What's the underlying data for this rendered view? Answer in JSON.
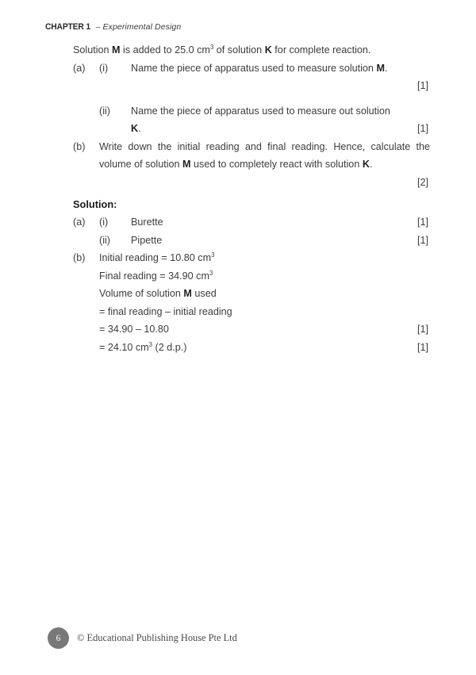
{
  "header": {
    "chapter_label": "CHAPTER 1",
    "separator": " – ",
    "chapter_title": "Experimental Design"
  },
  "question": {
    "stem_before": "Solution ",
    "stem_bold_1": "M",
    "stem_mid": " is added to 25.0 cm",
    "stem_sup": "3",
    "stem_after": " of solution ",
    "stem_bold_2": "K",
    "stem_end": " for complete reaction.",
    "parts": [
      {
        "label": "(a)",
        "sublabel": "(i)",
        "text_before": "Name the piece of apparatus used to measure solution ",
        "bold": "M",
        "text_after": ".",
        "marks": "[1]"
      },
      {
        "label": "",
        "sublabel": "(ii)",
        "text_before": "Name the piece of apparatus used to measure out solution ",
        "bold": "K",
        "text_after": ".",
        "marks": "[1]"
      },
      {
        "label": "(b)",
        "sublabel": "",
        "text_before": "Write down the initial reading and final reading. Hence, calculate the volume of solution ",
        "bold": "M",
        "text_mid": " used to completely react with solution ",
        "bold_2": "K",
        "text_after": ".",
        "marks": "[2]"
      }
    ]
  },
  "solution": {
    "heading": "Solution:",
    "a_label": "(a)",
    "items": [
      {
        "sublabel": "(i)",
        "text": "Burette",
        "marks": "[1]"
      },
      {
        "sublabel": "(ii)",
        "text": "Pipette",
        "marks": "[1]"
      }
    ],
    "b_label": "(b)",
    "b_lines": [
      {
        "text_before": "Initial reading = 10.80 cm",
        "sup": "3",
        "text_after": "",
        "marks": ""
      },
      {
        "text_before": "Final reading = 34.90 cm",
        "sup": "3",
        "text_after": "",
        "marks": ""
      },
      {
        "text_before": "Volume of solution ",
        "bold": "M",
        "text_after": " used",
        "marks": ""
      },
      {
        "text_before": "= final reading – initial reading",
        "text_after": "",
        "marks": ""
      },
      {
        "text_before": "= 34.90 – 10.80",
        "text_after": "",
        "marks": "[1]"
      },
      {
        "text_before": "= 24.10 cm",
        "sup": "3",
        "text_after": " (2 d.p.)",
        "marks": "[1]"
      }
    ]
  },
  "footer": {
    "page_number": "6",
    "copyright": "© Educational Publishing House Pte Ltd"
  }
}
